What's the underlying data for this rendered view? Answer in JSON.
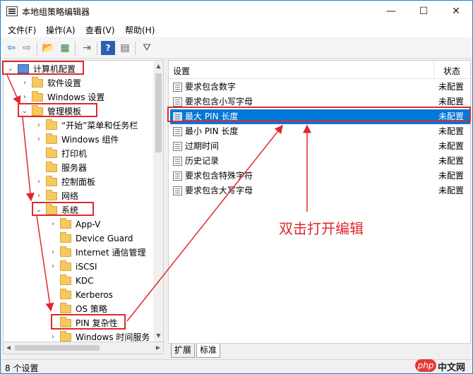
{
  "window": {
    "title": "本地组策略编辑器",
    "minimize": "—",
    "maximize": "☐",
    "close": "✕"
  },
  "menu": [
    "文件(F)",
    "操作(A)",
    "查看(V)",
    "帮助(H)"
  ],
  "toolbar": {
    "icons": [
      "back-icon",
      "forward-icon",
      "folder-up-icon",
      "show-hide-tree-icon",
      "export-list-icon",
      "help-icon",
      "properties-icon",
      "filter-icon"
    ],
    "glyphs": [
      "⇦",
      "⇨",
      "📂",
      "▦",
      "⇥",
      "?",
      "▤",
      "⛛"
    ]
  },
  "tree": [
    {
      "label": "计算机配置",
      "level": 0,
      "arrow": "⌄",
      "icon": "computer"
    },
    {
      "label": "软件设置",
      "level": 1,
      "arrow": "›",
      "icon": "folder"
    },
    {
      "label": "Windows 设置",
      "level": 1,
      "arrow": "›",
      "icon": "folder"
    },
    {
      "label": "管理模板",
      "level": 1,
      "arrow": "⌄",
      "icon": "folder"
    },
    {
      "label": "“开始”菜单和任务栏",
      "level": 2,
      "arrow": "›",
      "icon": "folder"
    },
    {
      "label": "Windows 组件",
      "level": 2,
      "arrow": "›",
      "icon": "folder"
    },
    {
      "label": "打印机",
      "level": 2,
      "arrow": "",
      "icon": "folder"
    },
    {
      "label": "服务器",
      "level": 2,
      "arrow": "",
      "icon": "folder"
    },
    {
      "label": "控制面板",
      "level": 2,
      "arrow": "›",
      "icon": "folder"
    },
    {
      "label": "网络",
      "level": 2,
      "arrow": "›",
      "icon": "folder"
    },
    {
      "label": "系统",
      "level": 2,
      "arrow": "⌄",
      "icon": "folder"
    },
    {
      "label": "App-V",
      "level": 3,
      "arrow": "›",
      "icon": "folder"
    },
    {
      "label": "Device Guard",
      "level": 3,
      "arrow": "",
      "icon": "folder"
    },
    {
      "label": "Internet 通信管理",
      "level": 3,
      "arrow": "›",
      "icon": "folder"
    },
    {
      "label": "iSCSI",
      "level": 3,
      "arrow": "›",
      "icon": "folder"
    },
    {
      "label": "KDC",
      "level": 3,
      "arrow": "",
      "icon": "folder"
    },
    {
      "label": "Kerberos",
      "level": 3,
      "arrow": "",
      "icon": "folder"
    },
    {
      "label": "OS 策略",
      "level": 3,
      "arrow": "",
      "icon": "folder"
    },
    {
      "label": "PIN 复杂性",
      "level": 3,
      "arrow": "",
      "icon": "folder"
    },
    {
      "label": "Windows 时间服务",
      "level": 3,
      "arrow": "›",
      "icon": "folder"
    }
  ],
  "list": {
    "col_setting": "设置",
    "col_state": "状态",
    "rows": [
      {
        "name": "要求包含数字",
        "state": "未配置"
      },
      {
        "name": "要求包含小写字母",
        "state": "未配置"
      },
      {
        "name": "最大 PIN 长度",
        "state": "未配置",
        "selected": true
      },
      {
        "name": "最小 PIN 长度",
        "state": "未配置"
      },
      {
        "name": "过期时间",
        "state": "未配置"
      },
      {
        "name": "历史记录",
        "state": "未配置"
      },
      {
        "name": "要求包含特殊字符",
        "state": "未配置"
      },
      {
        "name": "要求包含大写字母",
        "state": "未配置"
      }
    ]
  },
  "tabs": [
    "扩展",
    "标准"
  ],
  "status": "8 个设置",
  "annotation": {
    "text": "双击打开编辑",
    "color": "#e0282e"
  },
  "watermark": {
    "logo": "php",
    "text": "中文网"
  },
  "colors": {
    "accent": "#0078d7",
    "folder": "#f6c95e"
  }
}
